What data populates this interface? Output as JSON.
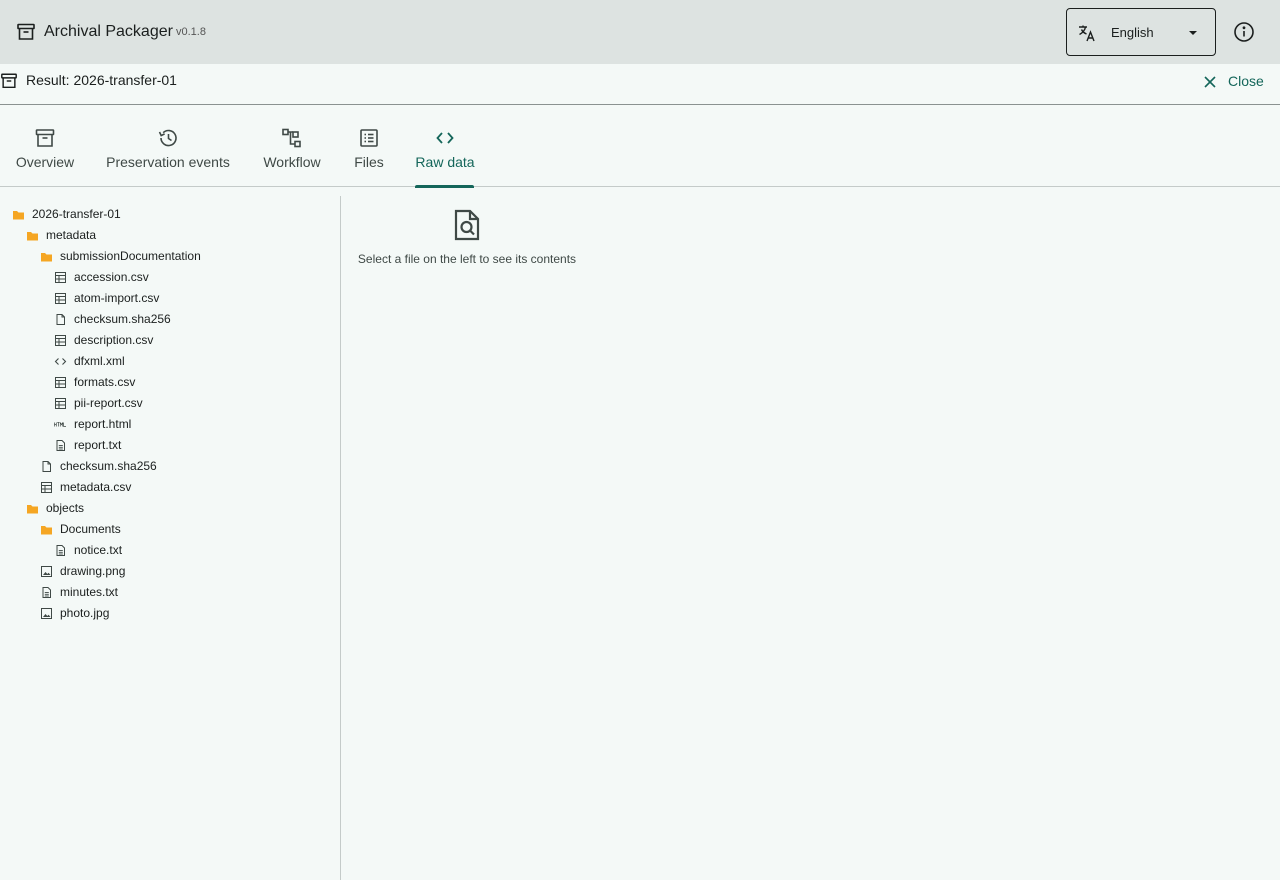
{
  "app": {
    "title": "Archival Packager",
    "version": "v0.1.8",
    "language": "English",
    "accent_color": "#14665a",
    "folder_color": "#f5a623"
  },
  "result": {
    "title": "Result: 2026-transfer-01",
    "close_label": "Close"
  },
  "tabs": [
    {
      "label": "Overview",
      "icon": "archive-box-icon",
      "active": false
    },
    {
      "label": "Preservation events",
      "icon": "history-icon",
      "active": false
    },
    {
      "label": "Workflow",
      "icon": "workflow-icon",
      "active": false
    },
    {
      "label": "Files",
      "icon": "list-icon",
      "active": false
    },
    {
      "label": "Raw data",
      "icon": "code-icon",
      "active": true
    }
  ],
  "tree": [
    {
      "label": "2026-transfer-01",
      "icon": "folder-icon",
      "depth": 0
    },
    {
      "label": "metadata",
      "icon": "folder-icon",
      "depth": 1
    },
    {
      "label": "submissionDocumentation",
      "icon": "folder-icon",
      "depth": 2
    },
    {
      "label": "accession.csv",
      "icon": "table-icon",
      "depth": 3
    },
    {
      "label": "atom-import.csv",
      "icon": "table-icon",
      "depth": 3
    },
    {
      "label": "checksum.sha256",
      "icon": "file-icon",
      "depth": 3
    },
    {
      "label": "description.csv",
      "icon": "table-icon",
      "depth": 3
    },
    {
      "label": "dfxml.xml",
      "icon": "code-icon",
      "depth": 3
    },
    {
      "label": "formats.csv",
      "icon": "table-icon",
      "depth": 3
    },
    {
      "label": "pii-report.csv",
      "icon": "table-icon",
      "depth": 3
    },
    {
      "label": "report.html",
      "icon": "html-icon",
      "depth": 3
    },
    {
      "label": "report.txt",
      "icon": "text-file-icon",
      "depth": 3
    },
    {
      "label": "checksum.sha256",
      "icon": "file-icon",
      "depth": 2
    },
    {
      "label": "metadata.csv",
      "icon": "table-icon",
      "depth": 2
    },
    {
      "label": "objects",
      "icon": "folder-icon",
      "depth": 1
    },
    {
      "label": "Documents",
      "icon": "folder-icon",
      "depth": 2
    },
    {
      "label": "notice.txt",
      "icon": "text-file-icon",
      "depth": 3
    },
    {
      "label": "drawing.png",
      "icon": "image-icon",
      "depth": 2
    },
    {
      "label": "minutes.txt",
      "icon": "text-file-icon",
      "depth": 2
    },
    {
      "label": "photo.jpg",
      "icon": "image-icon",
      "depth": 2
    }
  ],
  "viewer": {
    "empty_message": "Select a file on the left to see its contents",
    "icon": "file-search-icon"
  }
}
